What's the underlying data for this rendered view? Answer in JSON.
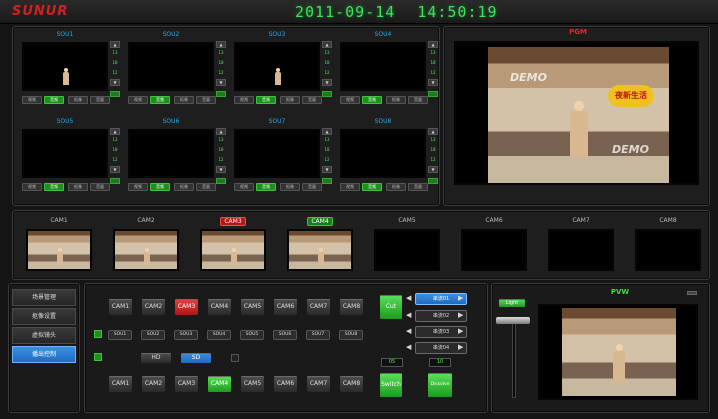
{
  "app": {
    "logo": "SUNUR",
    "date": "2011-09-14",
    "time": "14:50:19"
  },
  "sources": [
    {
      "label": "SOU1",
      "scene": "green",
      "person": true
    },
    {
      "label": "SOU2",
      "scene": "sky",
      "person": false
    },
    {
      "label": "SOU3",
      "scene": "studio",
      "person": true
    },
    {
      "label": "SOU4",
      "scene": "bars",
      "person": false
    },
    {
      "label": "SOU5",
      "scene": "galaxy",
      "person": false
    },
    {
      "label": "SOU6",
      "scene": "house",
      "person": false
    },
    {
      "label": "SOU7",
      "scene": "sunset",
      "person": false
    },
    {
      "label": "SOU8",
      "scene": "space",
      "person": false
    }
  ],
  "source_controls": {
    "b1": "视频",
    "b2": "音频",
    "b3": "抠像",
    "b4": "音量",
    "vol_top": "13",
    "vol_mid": "18",
    "vol_bot": "12"
  },
  "program": {
    "label": "PGM",
    "demo_top": "DEMO",
    "demo_bottom": "DEMO",
    "logo_text": "夜新生活"
  },
  "preview": {
    "label": "PVW"
  },
  "cameras": [
    {
      "label": "CAM1",
      "scene": "set",
      "state": "normal"
    },
    {
      "label": "CAM2",
      "scene": "set",
      "state": "normal"
    },
    {
      "label": "CAM3",
      "scene": "set",
      "state": "red"
    },
    {
      "label": "CAM4",
      "scene": "set",
      "state": "green"
    },
    {
      "label": "CAM5",
      "scene": "blank",
      "state": "normal"
    },
    {
      "label": "CAM6",
      "scene": "blank",
      "state": "normal"
    },
    {
      "label": "CAM7",
      "scene": "blank",
      "state": "normal"
    },
    {
      "label": "CAM8",
      "scene": "blank",
      "state": "normal"
    }
  ],
  "nav": [
    "场景管理",
    "抠像设置",
    "虚拟镜头",
    "播出控制"
  ],
  "pgm_row": [
    "CAM1",
    "CAM2",
    "CAM3",
    "CAM4",
    "CAM5",
    "CAM6",
    "CAM7",
    "CAM8"
  ],
  "sou_row": [
    "SOU1",
    "SOU2",
    "SOU3",
    "SOU4",
    "SOU5",
    "SOU6",
    "SOU7",
    "SOU8"
  ],
  "pvw_row": [
    "CAM1",
    "CAM2",
    "CAM3",
    "CAM4",
    "CAM5",
    "CAM6",
    "CAM7",
    "CAM8"
  ],
  "format": {
    "hd": "HD",
    "sd": "SD"
  },
  "cut": "Cut",
  "switch": "Switch",
  "dissolve": "Dissolve",
  "light": "Light",
  "channels": [
    "串流01",
    "串流02",
    "串流03",
    "串流04"
  ],
  "spin1": "05",
  "spin2": "10"
}
